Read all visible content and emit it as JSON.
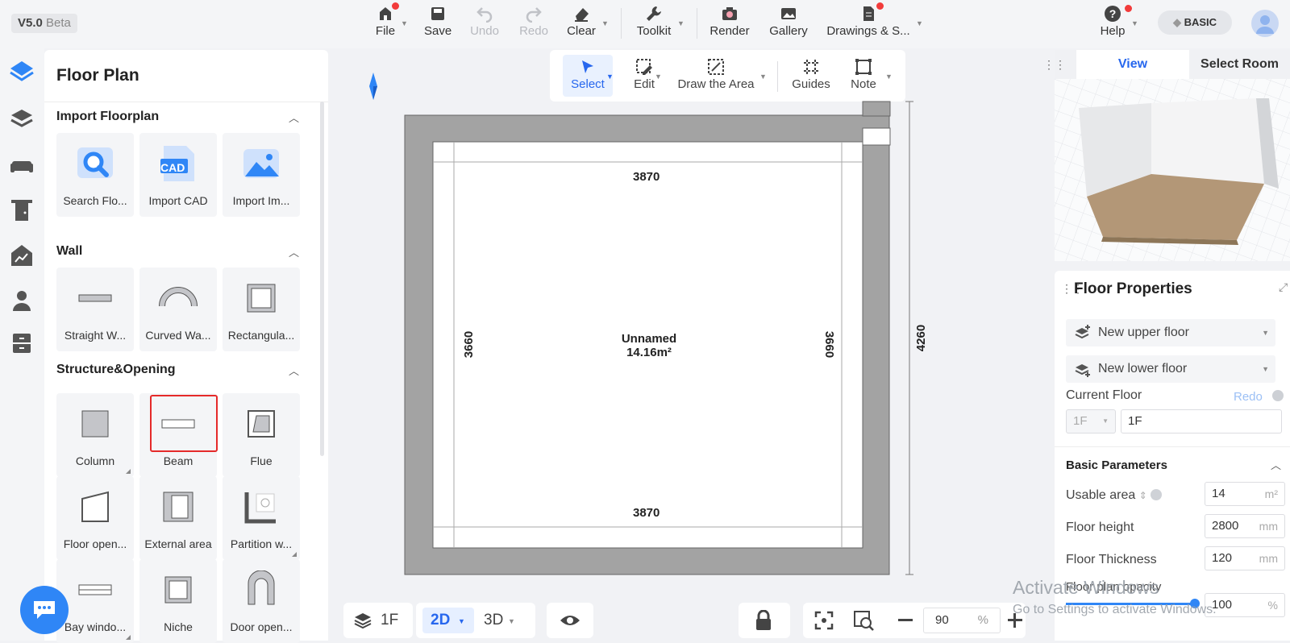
{
  "app": {
    "version": "V5.0",
    "version_tag": "Beta"
  },
  "toolbar": {
    "file": "File",
    "save": "Save",
    "undo": "Undo",
    "redo": "Redo",
    "clear": "Clear",
    "toolkit": "Toolkit",
    "render": "Render",
    "gallery": "Gallery",
    "drawings": "Drawings & S...",
    "help": "Help",
    "plan_badge": "BASIC"
  },
  "panel": {
    "title": "Floor Plan",
    "sections": {
      "import": {
        "title": "Import Floorplan",
        "items": [
          "Search Flo...",
          "Import CAD",
          "Import Im..."
        ],
        "cad_badge": "CAD"
      },
      "wall": {
        "title": "Wall",
        "items": [
          "Straight W...",
          "Curved Wa...",
          "Rectangula..."
        ]
      },
      "structure": {
        "title": "Structure&Opening",
        "items": [
          "Column",
          "Beam",
          "Flue",
          "Floor open...",
          "External area",
          "Partition w...",
          "Bay windo...",
          "Niche",
          "Door open..."
        ]
      }
    }
  },
  "canvas_toolbar": {
    "select": "Select",
    "edit": "Edit",
    "draw_area": "Draw the Area",
    "guides": "Guides",
    "note": "Note"
  },
  "room": {
    "name": "Unnamed",
    "area": "14.16m²",
    "dim_top": "3870",
    "dim_bottom": "3870",
    "dim_left": "3660",
    "dim_right": "3660",
    "dim_outer": "4260"
  },
  "bottom": {
    "floor": "1F",
    "mode_2d": "2D",
    "mode_3d": "3D",
    "zoom": "90",
    "zoom_unit": "%"
  },
  "right": {
    "tabs": {
      "view": "View",
      "select_room": "Select Room"
    },
    "floor_props": {
      "title": "Floor Properties",
      "new_upper": "New upper floor",
      "new_lower": "New lower floor",
      "current_floor_label": "Current Floor",
      "redo": "Redo",
      "floor_select": "1F",
      "floor_name": "1F",
      "basic_params": "Basic Parameters",
      "usable_area_label": "Usable area",
      "usable_area": "14",
      "usable_area_unit": "m²",
      "floor_height_label": "Floor height",
      "floor_height": "2800",
      "floor_height_unit": "mm",
      "floor_thickness_label": "Floor Thickness",
      "floor_thickness": "120",
      "floor_thickness_unit": "mm",
      "opacity_label": "Floor plan opacity",
      "opacity": "100",
      "opacity_unit": "%"
    }
  },
  "watermark": {
    "line1": "Activate Windows",
    "line2": "Go to Settings to activate Windows."
  },
  "colors": {
    "accent": "#2767ee",
    "wall": "#a3a3a3",
    "highlight": "#e52a2a"
  }
}
